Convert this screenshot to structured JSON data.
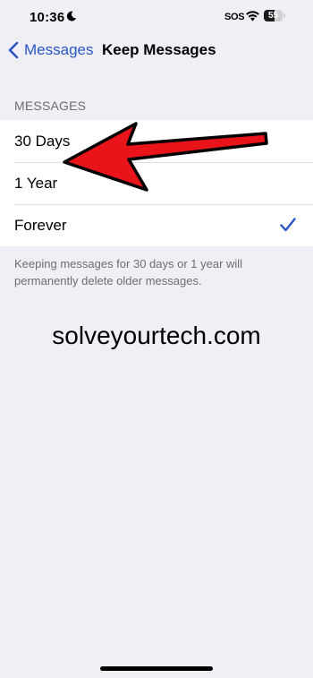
{
  "status_bar": {
    "time": "10:36",
    "moon_icon": "moon-icon",
    "sos": "SOS",
    "wifi_icon": "wifi-icon",
    "battery_level": "55"
  },
  "nav": {
    "back_label": "Messages",
    "title": "Keep Messages"
  },
  "section": {
    "header": "MESSAGES",
    "options": [
      {
        "label": "30 Days",
        "selected": false
      },
      {
        "label": "1 Year",
        "selected": false
      },
      {
        "label": "Forever",
        "selected": true
      }
    ],
    "footer": "Keeping messages for 30 days or 1 year will permanently delete older messages."
  },
  "watermark": "solveyourtech.com",
  "colors": {
    "accent": "#2a56c6",
    "annotation_arrow": "#e8141a",
    "background": "#f0eff5"
  }
}
